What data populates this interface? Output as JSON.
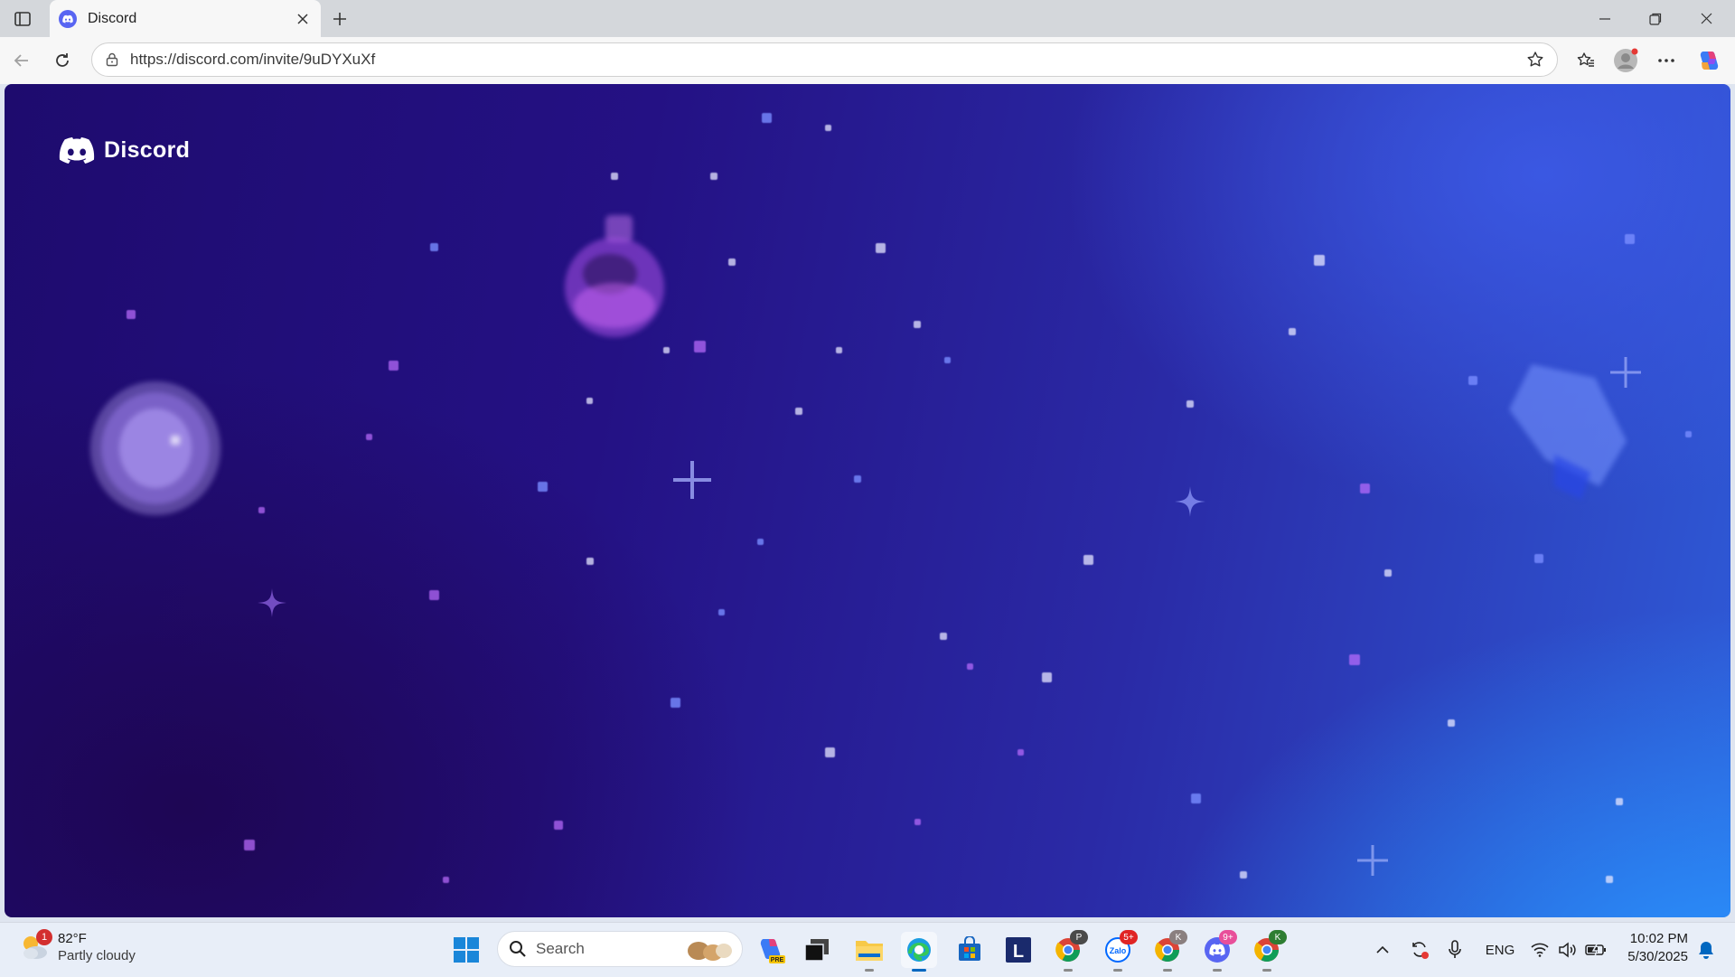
{
  "browser": {
    "tab": {
      "title": "Discord"
    },
    "address_bar": {
      "url": "https://discord.com/invite/9uDYXuXf"
    },
    "window_controls": [
      "minimize",
      "restore",
      "close"
    ]
  },
  "page": {
    "brand_name": "Discord"
  },
  "taskbar": {
    "weather": {
      "badge": "1",
      "temperature": "82°F",
      "condition": "Partly cloudy"
    },
    "search_label": "Search",
    "apps": [
      {
        "name": "start",
        "icon": "windows-logo-icon"
      },
      {
        "name": "copilot",
        "icon": "copilot-pre-icon",
        "label": "PRE"
      },
      {
        "name": "task-view",
        "icon": "task-view-icon"
      },
      {
        "name": "file-explorer",
        "icon": "folder-icon"
      },
      {
        "name": "edge",
        "icon": "edge-icon"
      },
      {
        "name": "store",
        "icon": "store-icon"
      },
      {
        "name": "l-app",
        "icon": "l-app-icon",
        "label": "L"
      },
      {
        "name": "chrome-p",
        "icon": "chrome-icon",
        "badge": "P"
      },
      {
        "name": "zalo",
        "icon": "zalo-icon",
        "label": "Zalo",
        "badge": "5+"
      },
      {
        "name": "chrome-k",
        "icon": "chrome-icon",
        "badge": "K"
      },
      {
        "name": "discord",
        "icon": "discord-icon",
        "badge": "9+"
      },
      {
        "name": "chrome-k2",
        "icon": "chrome-icon",
        "badge": "K"
      }
    ],
    "tray": {
      "language": "ENG"
    },
    "clock": {
      "time": "10:02 PM",
      "date": "5/30/2025"
    }
  }
}
